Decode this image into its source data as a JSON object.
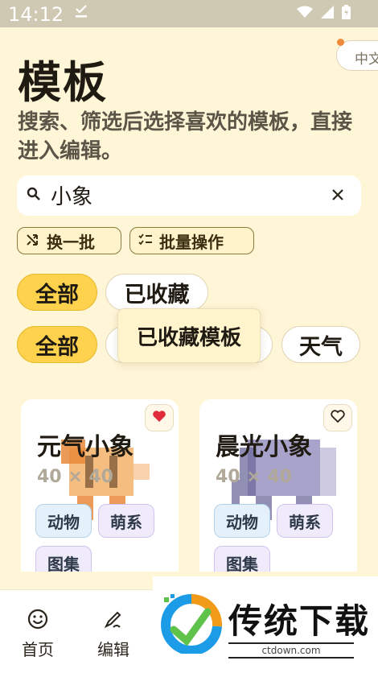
{
  "status_bar": {
    "time": "14:12"
  },
  "language_toggle": {
    "label": "中文"
  },
  "header": {
    "title": "模板",
    "subtitle": "搜索、筛选后选择喜欢的模板，直接进入编辑。"
  },
  "search": {
    "value": "小象",
    "placeholder": ""
  },
  "actions": {
    "shuffle_label": "换一批",
    "batch_label": "批量操作"
  },
  "filter_row1": [
    {
      "label": "全部",
      "active": true
    },
    {
      "label": "已收藏",
      "active": false
    }
  ],
  "filter_row2": [
    {
      "label": "全部",
      "active": true
    },
    {
      "label": "天气",
      "active": false
    }
  ],
  "tooltip": {
    "text": "已收藏模板"
  },
  "cards": [
    {
      "title": "元气小象",
      "size": "40 × 40",
      "favorited": true,
      "tags": [
        "动物",
        "萌系",
        "图集"
      ]
    },
    {
      "title": "晨光小象",
      "size": "40 × 40",
      "favorited": false,
      "tags": [
        "动物",
        "萌系",
        "图集"
      ]
    }
  ],
  "nav": [
    {
      "label": "首页",
      "icon": "smile-icon"
    },
    {
      "label": "编辑",
      "icon": "brush-icon"
    }
  ],
  "watermark": {
    "title": "传统下载",
    "url": "ctdown.com"
  },
  "colors": {
    "accent": "#ffd24d",
    "background": "#fff6d8",
    "favorite": "#e02b3a"
  }
}
